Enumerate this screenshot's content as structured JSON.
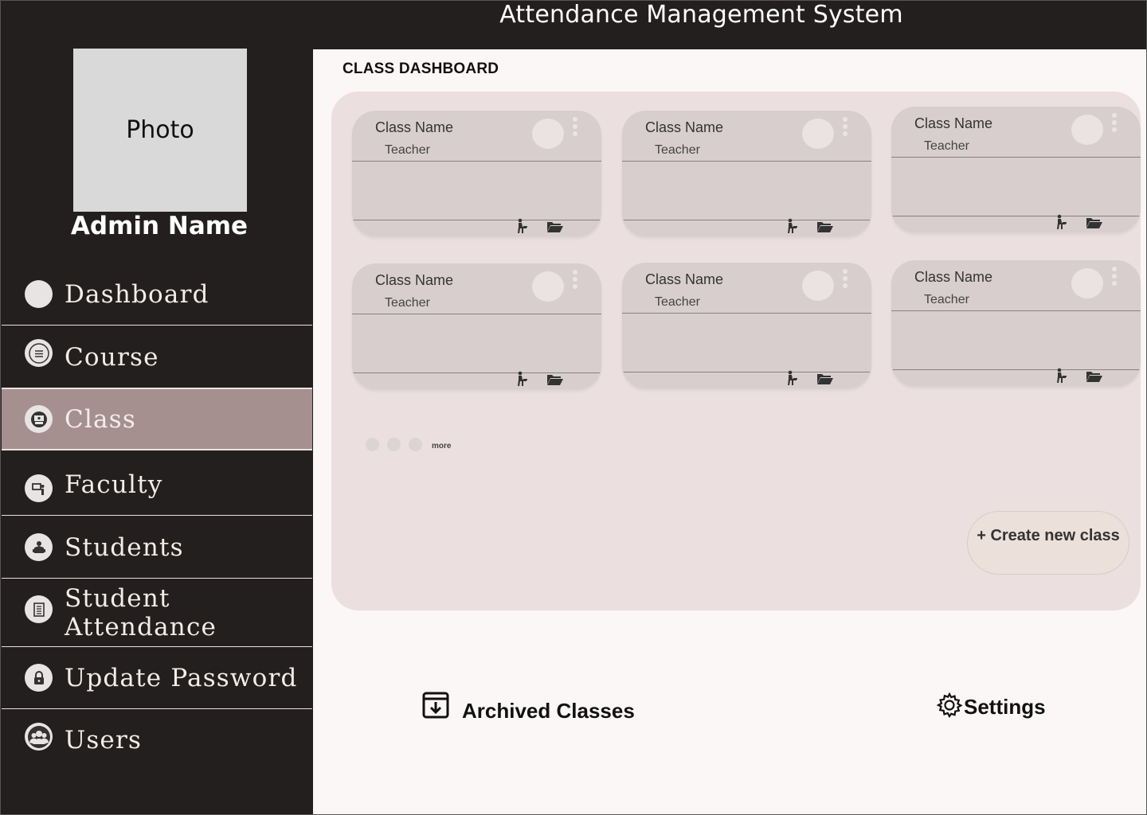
{
  "header": {
    "title": "Attendance Management System"
  },
  "profile": {
    "photo_label": "Photo",
    "name": "Admin Name"
  },
  "sidebar": {
    "items": [
      {
        "label": "Dashboard",
        "icon": "circle-icon"
      },
      {
        "label": "Course",
        "icon": "list-icon"
      },
      {
        "label": "Class",
        "icon": "classroom-icon",
        "active": true
      },
      {
        "label": "Faculty",
        "icon": "teacher-icon"
      },
      {
        "label": "Students",
        "icon": "student-icon"
      },
      {
        "label": "Student Attendance",
        "icon": "document-icon"
      },
      {
        "label": "Update Password",
        "icon": "lock-icon"
      },
      {
        "label": "Users",
        "icon": "users-icon"
      }
    ]
  },
  "main": {
    "title": "CLASS DASHBOARD",
    "cards": [
      {
        "name": "Class Name",
        "teacher": "Teacher"
      },
      {
        "name": "Class Name",
        "teacher": "Teacher"
      },
      {
        "name": "Class Name",
        "teacher": "Teacher"
      },
      {
        "name": "Class Name",
        "teacher": "Teacher"
      },
      {
        "name": "Class Name",
        "teacher": "Teacher"
      },
      {
        "name": "Class Name",
        "teacher": "Teacher"
      }
    ],
    "more_label": "more",
    "create_label": "+ Create new class",
    "archived_label": "Archived Classes",
    "settings_label": "Settings"
  },
  "colors": {
    "background": "#231f1e",
    "active_nav": "#a68f8f",
    "panel": "#ebdfdf",
    "card": "#d8cece"
  }
}
